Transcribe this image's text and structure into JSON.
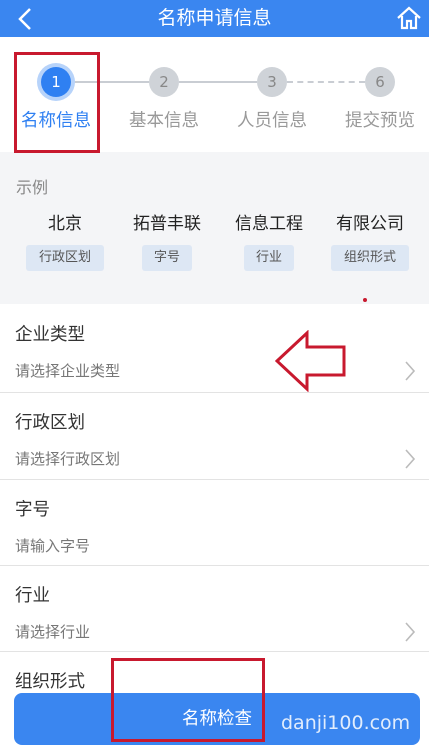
{
  "header": {
    "title": "名称申请信息",
    "back_icon": "chevron-left-icon",
    "home_icon": "home-icon",
    "color": "#3a86f0"
  },
  "steps": [
    {
      "number": "1",
      "label": "名称信息",
      "active": true
    },
    {
      "number": "2",
      "label": "基本信息",
      "active": false
    },
    {
      "number": "3",
      "label": "人员信息",
      "active": false
    },
    {
      "number": "6",
      "label": "提交预览",
      "active": false
    }
  ],
  "example": {
    "title": "示例",
    "parts": [
      {
        "word": "北京",
        "tag": "行政区划"
      },
      {
        "word": "拓普丰联",
        "tag": "字号"
      },
      {
        "word": "信息工程",
        "tag": "行业"
      },
      {
        "word": "有限公司",
        "tag": "组织形式"
      }
    ]
  },
  "form": {
    "fields": [
      {
        "label": "企业类型",
        "placeholder": "请选择企业类型",
        "has_chevron": true
      },
      {
        "label": "行政区划",
        "placeholder": "请选择行政区划",
        "has_chevron": true
      },
      {
        "label": "字号",
        "placeholder": "请输入字号",
        "has_chevron": false
      },
      {
        "label": "行业",
        "placeholder": "请选择行业",
        "has_chevron": true
      },
      {
        "label": "组织形式",
        "placeholder": "",
        "has_chevron": false
      }
    ]
  },
  "button": {
    "label": "名称检查"
  },
  "watermark": "danji100.com",
  "annotation_color": "#c8192e"
}
